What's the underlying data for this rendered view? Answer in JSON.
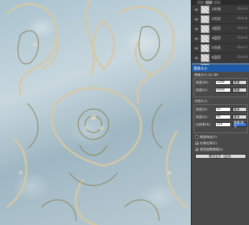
{
  "layers": {
    "items": [
      {
        "name": "1织物",
        "shortcut": "Ctrl+3"
      },
      {
        "name": "2花纹",
        "shortcut": "Ctrl+4"
      },
      {
        "name": "3图层",
        "shortcut": "Ctrl+5"
      },
      {
        "name": "4图层",
        "shortcut": "Ctrl+6"
      },
      {
        "name": "5背景",
        "shortcut": "Ctrl+7"
      },
      {
        "name": "6图层",
        "shortcut": "Ctrl+8"
      },
      {
        "name": "3通道",
        "shortcut": "Ctrl+9"
      }
    ],
    "selected_index": 6
  },
  "dialog": {
    "title": "图像大小",
    "pixel_size": "像素大小:32.3M",
    "width_label": "宽度(W):",
    "width_value": "5300",
    "width_unit": "像素",
    "height_label": "高度(H):",
    "height_value": "6400",
    "height_unit": "像素",
    "doc_size": "文档大小:",
    "doc_width_label": "宽度(D):",
    "doc_width_value": "53",
    "doc_width_unit": "厘米",
    "doc_height_label": "高度(G):",
    "doc_height_value": "64",
    "doc_height_unit": "厘米",
    "res_label": "分辨率(R):",
    "res_value": "254",
    "res_unit": "像素/英寸",
    "scale_styles": "缩放样式(Y)",
    "constrain": "约束比例(C)",
    "resample": "重定图像像素(I):",
    "resample_method": "两次立方（自动）"
  },
  "colors": {
    "selected_layer": "#5a6f8c",
    "dialog_title": "#1e5aa8"
  }
}
